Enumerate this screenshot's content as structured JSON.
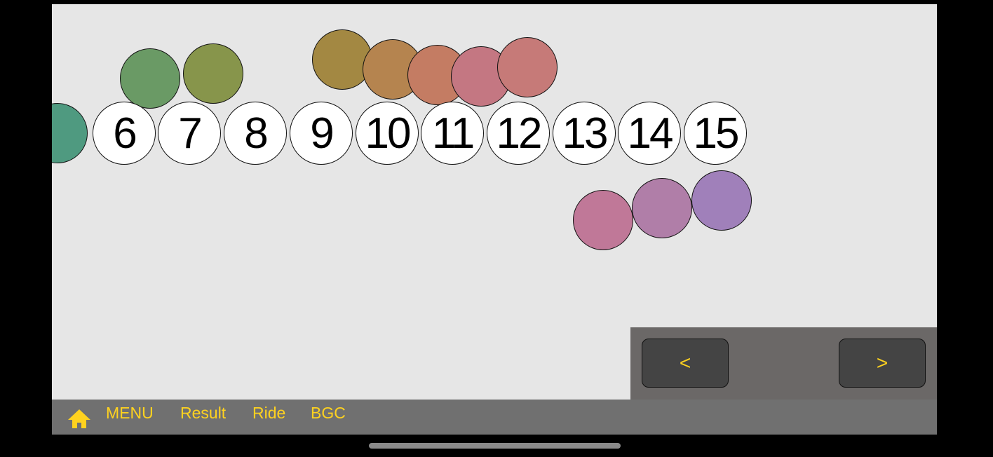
{
  "numbers": [
    "6",
    "7",
    "8",
    "9",
    "10",
    "11",
    "12",
    "13",
    "14",
    "15"
  ],
  "balls": [
    {
      "color": "#4f9a80"
    },
    {
      "color": "#6a9a65"
    },
    {
      "color": "#87954b"
    },
    {
      "color": "#a38842"
    },
    {
      "color": "#b5844f"
    },
    {
      "color": "#c47c63"
    },
    {
      "color": "#c47782"
    },
    {
      "color": "#c67a78"
    },
    {
      "color": "#c07898"
    },
    {
      "color": "#b07ea8"
    },
    {
      "color": "#a080ba"
    }
  ],
  "nav": {
    "prev_label": "<",
    "next_label": ">"
  },
  "menu": {
    "menu_label": "MENU",
    "result_label": "Result",
    "ride_label": "Ride",
    "bgc_label": "BGC"
  },
  "colors": {
    "accent": "#ffd21f",
    "background": "#e6e6e6",
    "bar": "#707070",
    "panel": "#6b6867"
  },
  "icons": {
    "home": "home-icon"
  }
}
